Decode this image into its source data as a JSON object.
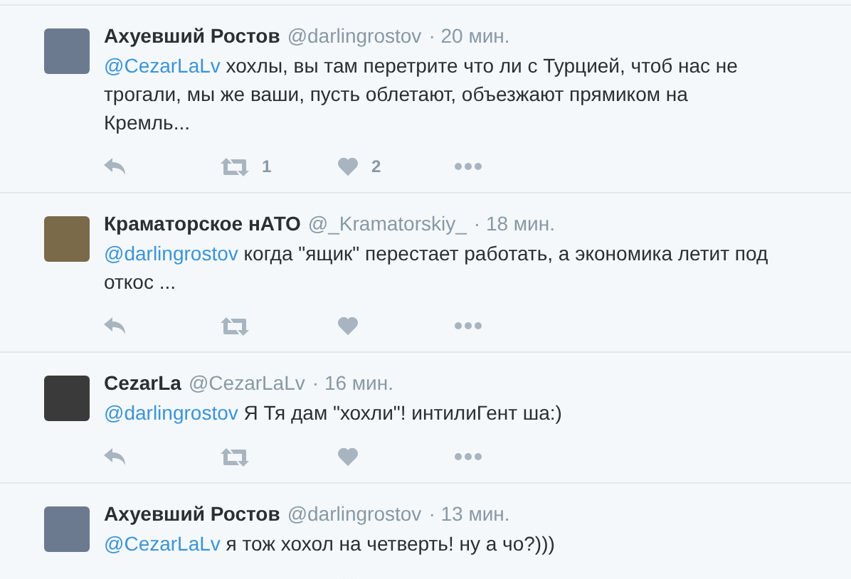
{
  "tweets": [
    {
      "name": "Ахуевший Ростов",
      "handle": "@darlingrostov",
      "time": "· 20 мин.",
      "mention": "@CezarLaLv",
      "text": " хохлы, вы там перетрите что ли с Турцией, чтоб нас не трогали, мы же ваши, пусть облетают, объезжают прямиком на Кремль...",
      "retweets": "1",
      "likes": "2"
    },
    {
      "name": "Краматорское нАТО",
      "handle": "@_Kramatorskiy_",
      "time": "· 18 мин.",
      "mention": "@darlingrostov",
      "text": " когда \"ящик\" перестает работать, а экономика летит под откос ..."
    },
    {
      "name": "CezarLa",
      "handle": "@CezarLaLv",
      "time": "· 16 мин.",
      "mention": "@darlingrostov",
      "text": " Я Тя дам \"хохли\"! интилиГент ша:)"
    },
    {
      "name": "Ахуевший Ростов",
      "handle": "@darlingrostov",
      "time": "· 13 мин.",
      "mention": "@CezarLaLv",
      "text": " я тож хохол на четверть! ну а чо?)))"
    }
  ]
}
